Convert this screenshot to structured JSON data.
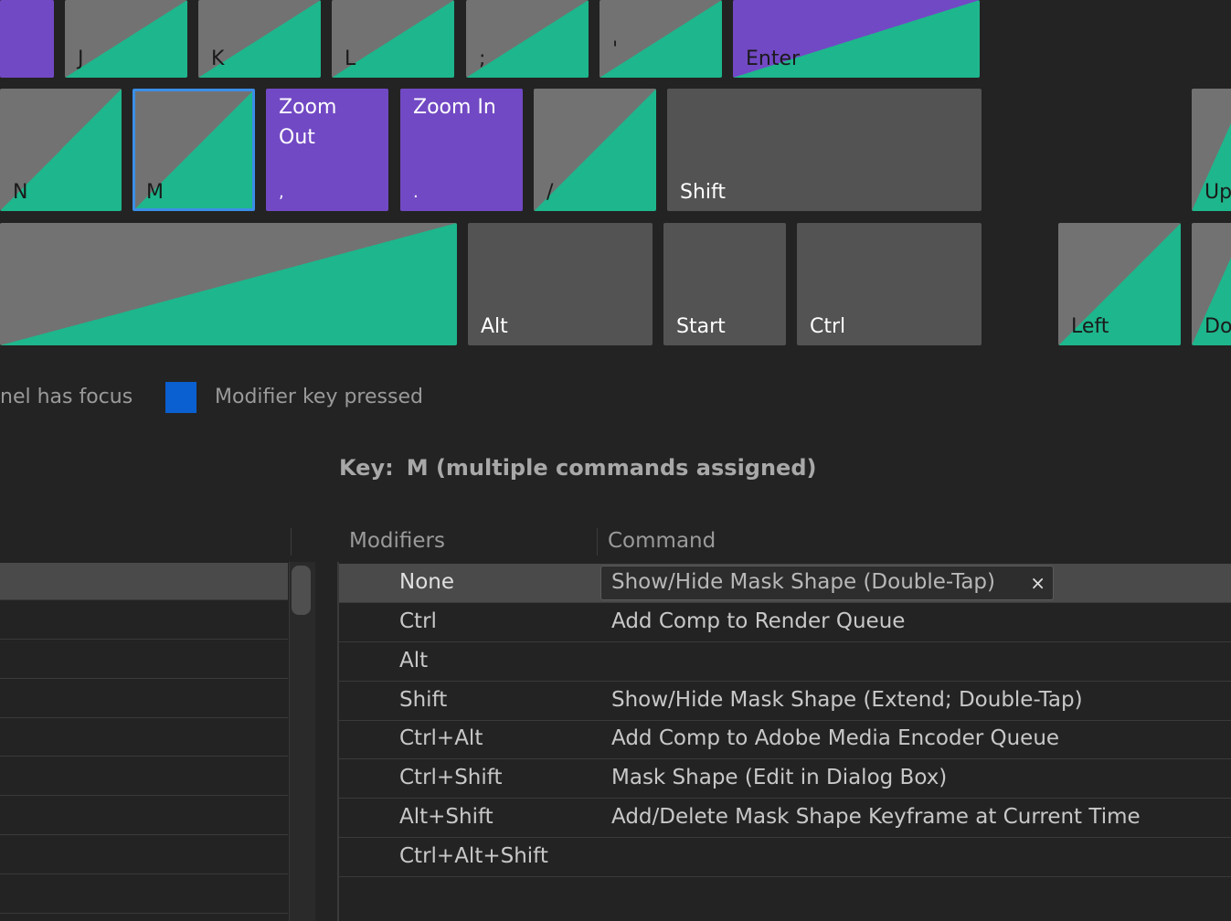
{
  "keyboard": {
    "row1": [
      "",
      "J",
      "K",
      "L",
      ";",
      "'",
      "Enter"
    ],
    "row2": {
      "n": "N",
      "m": "M",
      "comma_cmd": "Zoom\nOut",
      "comma": ",",
      "period_cmd": "Zoom In",
      "period": ".",
      "slash": "/",
      "shift": "Shift",
      "up": "Up"
    },
    "row3": {
      "alt": "Alt",
      "start": "Start",
      "ctrl": "Ctrl",
      "left": "Left",
      "down": "Do"
    }
  },
  "legend": {
    "panel_focus": "nel has focus",
    "modifier_pressed": "Modifier key pressed",
    "modifier_color": "#0a5fd1"
  },
  "key_info": {
    "prefix": "Key:",
    "value": "M (multiple commands assigned)"
  },
  "table": {
    "headers": {
      "modifiers": "Modifiers",
      "command": "Command"
    },
    "rows": [
      {
        "modifier": "None",
        "command": "Show/Hide Mask Shape (Double-Tap)"
      },
      {
        "modifier": "Ctrl",
        "command": "Add Comp to Render Queue"
      },
      {
        "modifier": "Alt",
        "command": ""
      },
      {
        "modifier": "Shift",
        "command": "Show/Hide Mask Shape (Extend; Double-Tap)"
      },
      {
        "modifier": "Ctrl+Alt",
        "command": "Add Comp to Adobe Media Encoder Queue"
      },
      {
        "modifier": "Ctrl+Shift",
        "command": "Mask Shape (Edit in Dialog Box)"
      },
      {
        "modifier": "Alt+Shift",
        "command": "Add/Delete Mask Shape Keyframe at Current Time"
      },
      {
        "modifier": "Ctrl+Alt+Shift",
        "command": ""
      }
    ],
    "clear_glyph": "×"
  },
  "colors": {
    "app_assigned": "#1eb68c",
    "panel_assigned": "#7249c4",
    "selected_outline": "#3b8ee8"
  }
}
